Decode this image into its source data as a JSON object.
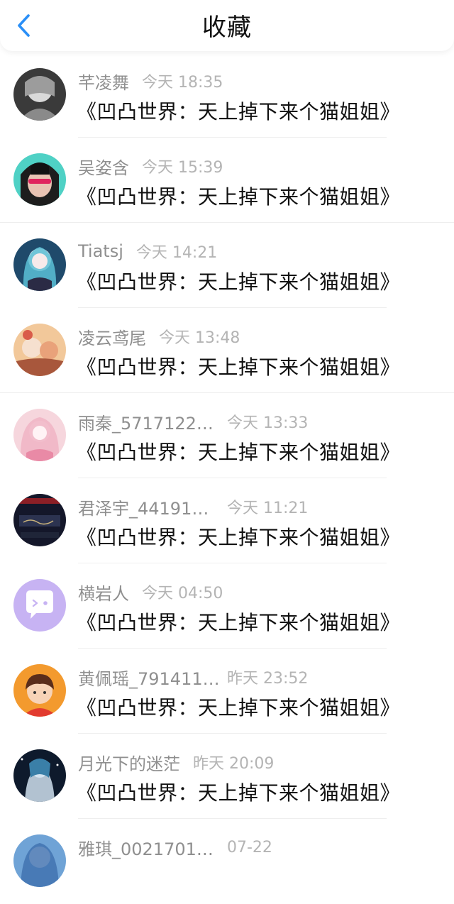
{
  "header": {
    "title": "收藏",
    "back_icon": "chevron-left-icon",
    "accent": "#2a8ff7"
  },
  "items": [
    {
      "name": "芊凌舞",
      "time": "今天 18:35",
      "book": "《凹凸世界：天上掉下来个猫姐姐》",
      "avatar_icon": "user-avatar-icon"
    },
    {
      "name": "吴姿含",
      "time": "今天 15:39",
      "book": "《凹凸世界：天上掉下来个猫姐姐》",
      "avatar_icon": "user-avatar-icon"
    },
    {
      "name": "Tiatsj",
      "time": "今天 14:21",
      "book": "《凹凸世界：天上掉下来个猫姐姐》",
      "avatar_icon": "user-avatar-icon"
    },
    {
      "name": "凌云鸢尾",
      "time": "今天 13:48",
      "book": "《凹凸世界：天上掉下来个猫姐姐》",
      "avatar_icon": "user-avatar-icon"
    },
    {
      "name": "雨秦_5717122…",
      "time": "今天 13:33",
      "book": "《凹凸世界：天上掉下来个猫姐姐》",
      "avatar_icon": "user-avatar-icon"
    },
    {
      "name": "君泽宇_44191…",
      "time": "今天 11:21",
      "book": "《凹凸世界：天上掉下来个猫姐姐》",
      "avatar_icon": "user-avatar-icon"
    },
    {
      "name": "横岩人",
      "time": "今天 04:50",
      "book": "《凹凸世界：天上掉下来个猫姐姐》",
      "avatar_icon": "chat-bubble-avatar-icon"
    },
    {
      "name": "黄佩瑶_791411…",
      "time": "昨天 23:52",
      "book": "《凹凸世界：天上掉下来个猫姐姐》",
      "avatar_icon": "user-avatar-icon"
    },
    {
      "name": "月光下的迷茫",
      "time": "昨天 20:09",
      "book": "《凹凸世界：天上掉下来个猫姐姐》",
      "avatar_icon": "user-avatar-icon"
    },
    {
      "name": "雅琪_0021701…",
      "time": "07-22",
      "book": "",
      "avatar_icon": "user-avatar-icon"
    }
  ]
}
